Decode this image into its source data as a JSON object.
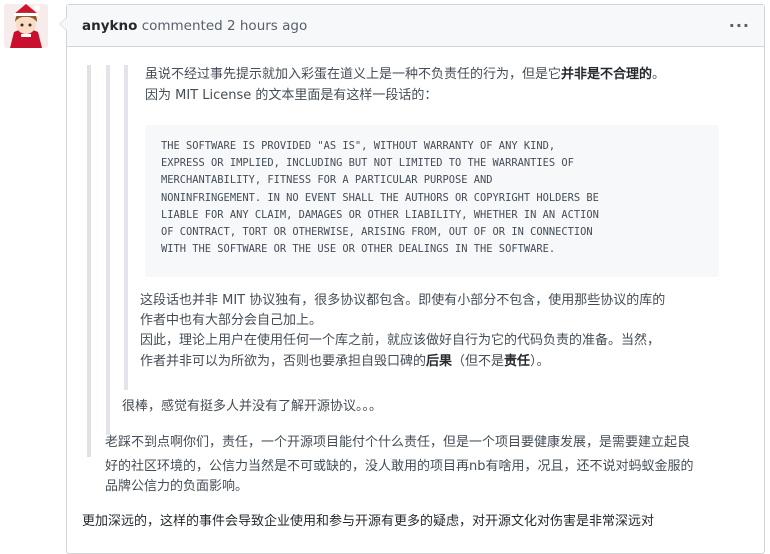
{
  "comment": {
    "author": "anykno",
    "action": "commented",
    "time": "2 hours ago",
    "menu_icon": "kebab-horizontal-icon"
  },
  "quote_level3": {
    "line1_pre": "虽说不经过事先提示就加入彩蛋在道义上是一种不负责任的行为，但是它",
    "line1_bold": "并非是不合理的",
    "line1_end": "。",
    "line2": "因为 MIT License 的文本里面是有这样一段话的：",
    "license_text": "THE SOFTWARE IS PROVIDED \"AS IS\", WITHOUT WARRANTY OF ANY KIND,\nEXPRESS OR IMPLIED, INCLUDING BUT NOT LIMITED TO THE WARRANTIES OF\nMERCHANTABILITY, FITNESS FOR A PARTICULAR PURPOSE AND\nNONINFRINGEMENT. IN NO EVENT SHALL THE AUTHORS OR COPYRIGHT HOLDERS BE\nLIABLE FOR ANY CLAIM, DAMAGES OR OTHER LIABILITY, WHETHER IN AN ACTION\nOF CONTRACT, TORT OR OTHERWISE, ARISING FROM, OUT OF OR IN CONNECTION\nWITH THE SOFTWARE OR THE USE OR OTHER DEALINGS IN THE SOFTWARE.",
    "para2_line1": "这段话也并非 MIT 协议独有，很多协议都包含。即使有小部分不包含，使用那些协议的库的",
    "para2_line2": "作者中也有大部分会自己加上。",
    "para3_line1": "因此，理论上用户在使用任何一个库之前，就应该做好自行为它的代码负责的准备。当然，",
    "para3_line2_pre": "作者并非可以为所欲为，否则也要承担自毁口碑的",
    "para3_line2_bold1": "后果",
    "para3_line2_mid": "（但不是",
    "para3_line2_bold2": "责任",
    "para3_line2_end": "）。"
  },
  "quote_level2": {
    "text": "很棒，感觉有挺多人并没有了解开源协议。。。"
  },
  "quote_level1": {
    "line1": "老踩不到点啊你们，责任，一个开源项目能付个什么责任，但是一个项目要健康发展，是需要建立起良",
    "line2": "好的社区环境的，公信力当然是不可或缺的，没人敢用的项目再nb有啥用，况且，还不说对蚂蚁金服的",
    "line3": "品牌公信力的负面影响。"
  },
  "reply_text": "更加深远的，这样的事件会导致企业使用和参与开源有更多的疑虑，对开源文化对伤害是非常深远对"
}
